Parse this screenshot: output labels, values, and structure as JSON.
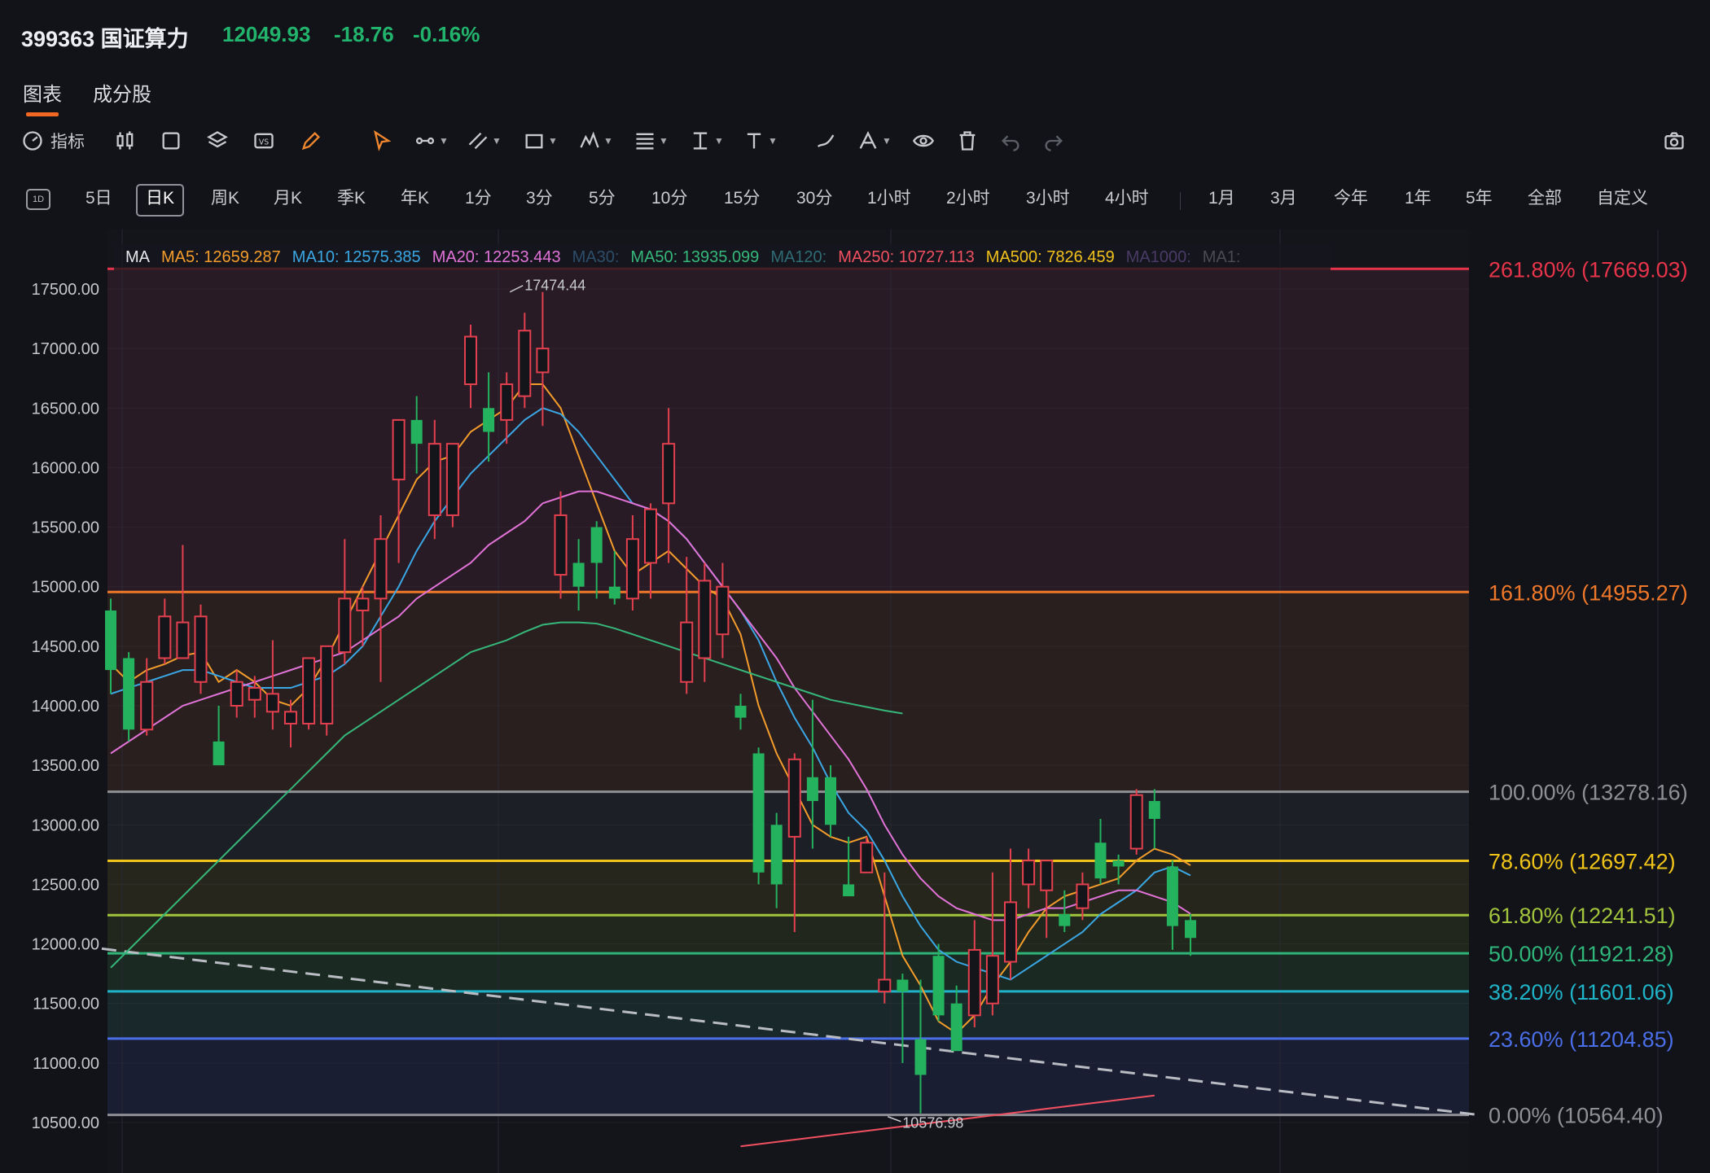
{
  "ticker": {
    "code_name": "399363 国证算力",
    "price": "12049.93",
    "change": "-18.76",
    "change_pct": "-0.16%"
  },
  "tabs": [
    {
      "label": "图表",
      "active": true
    },
    {
      "label": "成分股",
      "active": false
    }
  ],
  "toolbar": {
    "indicator_label": "指标",
    "icons": [
      "indicator-icon",
      "candle-type-icon",
      "square-icon",
      "layers-icon",
      "compare-icon",
      "pencil-icon",
      "cursor-icon",
      "line-tool-icon",
      "channel-icon",
      "shape-icon",
      "pattern-icon",
      "fib-icon",
      "measure-icon",
      "text-icon",
      "brush-icon",
      "annotation-icon",
      "eye-icon",
      "trash-icon",
      "undo-icon",
      "redo-icon",
      "camera-icon"
    ]
  },
  "periods": {
    "icon_label": "1D",
    "items": [
      "5日",
      "日K",
      "周K",
      "月K",
      "季K",
      "年K",
      "1分",
      "3分",
      "5分",
      "10分",
      "15分",
      "30分",
      "1小时",
      "2小时",
      "3小时",
      "4小时",
      "1月",
      "3月",
      "今年",
      "1年",
      "5年",
      "全部",
      "自定义"
    ],
    "active": "日K"
  },
  "ma_legend": [
    {
      "label": "MA",
      "color": "#e6e7ea"
    },
    {
      "label": "MA5: 12659.287",
      "color": "#f39c2b"
    },
    {
      "label": "MA10: 12575.385",
      "color": "#3aa6e3"
    },
    {
      "label": "MA20: 12253.443",
      "color": "#e173d8"
    },
    {
      "label": "MA30:",
      "color": "#2d4d6a"
    },
    {
      "label": "MA50: 13935.099",
      "color": "#36b77a"
    },
    {
      "label": "MA120:",
      "color": "#2f6b74"
    },
    {
      "label": "MA250: 10727.113",
      "color": "#f05060"
    },
    {
      "label": "MA500: 7826.459",
      "color": "#f2c11d"
    },
    {
      "label": "MA1000:",
      "color": "#4a3a66"
    },
    {
      "label": "MA1:",
      "color": "#4a4b52"
    }
  ],
  "chart_data": {
    "type": "candlestick",
    "y_axis": {
      "min": 10300,
      "max": 17800,
      "ticks": [
        17500,
        17000,
        16500,
        16000,
        15500,
        15000,
        14500,
        14000,
        13500,
        13000,
        12500,
        12000,
        11500,
        11000,
        10500
      ],
      "tick_labels": [
        "17500.00",
        "17000.00",
        "16500.00",
        "16000.00",
        "15500.00",
        "15000.00",
        "14500.00",
        "14000.00",
        "13500.00",
        "13000.00",
        "12500.00",
        "12000.00",
        "11500.00",
        "11000.00",
        "10500.00"
      ]
    },
    "annotations": [
      {
        "label": "17474.44",
        "value": 17474.44,
        "bar": 22
      },
      {
        "label": "10576.98",
        "value": 10576.98,
        "bar": 43
      }
    ],
    "fibonacci": [
      {
        "level": "261.80%",
        "value": 17669.03,
        "label": "261.80% (17669.03)",
        "color": "#e8344a"
      },
      {
        "level": "161.80%",
        "value": 14955.27,
        "label": "161.80% (14955.27)",
        "color": "#f0782a"
      },
      {
        "level": "100.00%",
        "value": 13278.16,
        "label": "100.00% (13278.16)",
        "color": "#8e9096"
      },
      {
        "level": "78.60%",
        "value": 12697.42,
        "label": "78.60% (12697.42)",
        "color": "#f0c419"
      },
      {
        "level": "61.80%",
        "value": 12241.51,
        "label": "61.80% (12241.51)",
        "color": "#a2c43c"
      },
      {
        "level": "50.00%",
        "value": 11921.28,
        "label": "50.00% (11921.28)",
        "color": "#2fb57a"
      },
      {
        "level": "38.20%",
        "value": 11601.06,
        "label": "38.20% (11601.06)",
        "color": "#1fb3c8"
      },
      {
        "level": "23.60%",
        "value": 11204.85,
        "label": "23.60% (11204.85)",
        "color": "#4a6ee8"
      },
      {
        "level": "0.00%",
        "value": 10564.4,
        "label": "0.00% (10564.40)",
        "color": "#8e9096"
      }
    ],
    "candles": [
      {
        "o": 14800,
        "h": 14900,
        "l": 14100,
        "c": 14300
      },
      {
        "o": 14400,
        "h": 14450,
        "l": 13700,
        "c": 13800
      },
      {
        "o": 13800,
        "h": 14400,
        "l": 13750,
        "c": 14200
      },
      {
        "o": 14400,
        "h": 14900,
        "l": 14350,
        "c": 14750
      },
      {
        "o": 14400,
        "h": 15350,
        "l": 14400,
        "c": 14700
      },
      {
        "o": 14200,
        "h": 14850,
        "l": 14100,
        "c": 14750
      },
      {
        "o": 13700,
        "h": 14000,
        "l": 13550,
        "c": 13500
      },
      {
        "o": 14000,
        "h": 14300,
        "l": 13900,
        "c": 14200
      },
      {
        "o": 14050,
        "h": 14250,
        "l": 13900,
        "c": 14150
      },
      {
        "o": 13950,
        "h": 14550,
        "l": 13800,
        "c": 14100
      },
      {
        "o": 13850,
        "h": 14050,
        "l": 13650,
        "c": 13950
      },
      {
        "o": 13850,
        "h": 14200,
        "l": 13800,
        "c": 14400
      },
      {
        "o": 13850,
        "h": 14500,
        "l": 13750,
        "c": 14500
      },
      {
        "o": 14450,
        "h": 15400,
        "l": 14350,
        "c": 14900
      },
      {
        "o": 14800,
        "h": 15000,
        "l": 14500,
        "c": 14900
      },
      {
        "o": 14900,
        "h": 15600,
        "l": 14200,
        "c": 15400
      },
      {
        "o": 15900,
        "h": 16300,
        "l": 15200,
        "c": 16400
      },
      {
        "o": 16400,
        "h": 16600,
        "l": 15950,
        "c": 16200
      },
      {
        "o": 15600,
        "h": 16400,
        "l": 15400,
        "c": 16200
      },
      {
        "o": 15600,
        "h": 16200,
        "l": 15500,
        "c": 16200
      },
      {
        "o": 16700,
        "h": 17200,
        "l": 16500,
        "c": 17100
      },
      {
        "o": 16500,
        "h": 16800,
        "l": 16050,
        "c": 16300
      },
      {
        "o": 16400,
        "h": 16800,
        "l": 16200,
        "c": 16700
      },
      {
        "o": 16600,
        "h": 17300,
        "l": 16500,
        "c": 17150
      },
      {
        "o": 16800,
        "h": 17474.44,
        "l": 16350,
        "c": 17000
      },
      {
        "o": 15100,
        "h": 15800,
        "l": 14900,
        "c": 15600
      },
      {
        "o": 15200,
        "h": 15400,
        "l": 14800,
        "c": 15000
      },
      {
        "o": 15500,
        "h": 15550,
        "l": 14900,
        "c": 15200
      },
      {
        "o": 15000,
        "h": 15300,
        "l": 14850,
        "c": 14900
      },
      {
        "o": 14900,
        "h": 15600,
        "l": 14800,
        "c": 15400
      },
      {
        "o": 15200,
        "h": 15700,
        "l": 14900,
        "c": 15650
      },
      {
        "o": 15700,
        "h": 16500,
        "l": 15200,
        "c": 16200
      },
      {
        "o": 14200,
        "h": 15250,
        "l": 14100,
        "c": 14700
      },
      {
        "o": 14400,
        "h": 15200,
        "l": 14200,
        "c": 15050
      },
      {
        "o": 14600,
        "h": 15200,
        "l": 14400,
        "c": 15000
      },
      {
        "o": 14000,
        "h": 14100,
        "l": 13800,
        "c": 13900
      },
      {
        "o": 13600,
        "h": 13650,
        "l": 12500,
        "c": 12600
      },
      {
        "o": 13000,
        "h": 13100,
        "l": 12300,
        "c": 12500
      },
      {
        "o": 12900,
        "h": 13600,
        "l": 12100,
        "c": 13550
      },
      {
        "o": 13400,
        "h": 14050,
        "l": 12800,
        "c": 13200
      },
      {
        "o": 13400,
        "h": 13500,
        "l": 12900,
        "c": 13000
      },
      {
        "o": 12500,
        "h": 12900,
        "l": 12400,
        "c": 12400
      },
      {
        "o": 12600,
        "h": 12900,
        "l": 12600,
        "c": 12850
      },
      {
        "o": 11600,
        "h": 12600,
        "l": 11500,
        "c": 11700
      },
      {
        "o": 11700,
        "h": 11750,
        "l": 11000,
        "c": 11600
      },
      {
        "o": 11200,
        "h": 11700,
        "l": 10576.98,
        "c": 10900
      },
      {
        "o": 11900,
        "h": 12000,
        "l": 11350,
        "c": 11400
      },
      {
        "o": 11500,
        "h": 11650,
        "l": 11400,
        "c": 11100
      },
      {
        "o": 11400,
        "h": 12200,
        "l": 11300,
        "c": 11950
      },
      {
        "o": 11500,
        "h": 12600,
        "l": 11400,
        "c": 11900
      },
      {
        "o": 11850,
        "h": 12800,
        "l": 11700,
        "c": 12350
      },
      {
        "o": 12500,
        "h": 12800,
        "l": 12300,
        "c": 12700
      },
      {
        "o": 12450,
        "h": 12700,
        "l": 12050,
        "c": 12700
      },
      {
        "o": 12250,
        "h": 12450,
        "l": 12100,
        "c": 12150
      },
      {
        "o": 12300,
        "h": 12600,
        "l": 12200,
        "c": 12500
      },
      {
        "o": 12850,
        "h": 13050,
        "l": 12500,
        "c": 12550
      },
      {
        "o": 12700,
        "h": 12750,
        "l": 12500,
        "c": 12650
      },
      {
        "o": 12800,
        "h": 13300,
        "l": 12750,
        "c": 13250
      },
      {
        "o": 13200,
        "h": 13300,
        "l": 12800,
        "c": 13050
      },
      {
        "o": 12650,
        "h": 12700,
        "l": 11950,
        "c": 12150
      },
      {
        "o": 12200,
        "h": 12250,
        "l": 11900,
        "c": 12050
      }
    ],
    "ma_lines": [
      {
        "name": "MA5",
        "color": "#f39c2b",
        "values": [
          14350,
          14200,
          14300,
          14350,
          14420,
          14450,
          14200,
          14300,
          14200,
          14050,
          14000,
          14150,
          14400,
          14700,
          15000,
          15300,
          15600,
          15900,
          16050,
          16100,
          16300,
          16400,
          16500,
          16700,
          16700,
          16500,
          16100,
          15700,
          15300,
          15100,
          15200,
          15300,
          15150,
          15000,
          14900,
          14600,
          14000,
          13600,
          13300,
          13000,
          12900,
          12850,
          12900,
          12400,
          11900,
          11650,
          11350,
          11250,
          11400,
          11650,
          11850,
          12100,
          12300,
          12400,
          12450,
          12500,
          12550,
          12700,
          12800,
          12750,
          12660
        ]
      },
      {
        "name": "MA10",
        "color": "#3aa6e3",
        "values": [
          14100,
          14150,
          14200,
          14250,
          14300,
          14300,
          14250,
          14200,
          14150,
          14150,
          14150,
          14200,
          14250,
          14350,
          14500,
          14750,
          15000,
          15300,
          15550,
          15750,
          15950,
          16100,
          16250,
          16400,
          16500,
          16450,
          16300,
          16100,
          15900,
          15700,
          15650,
          15550,
          15400,
          15200,
          15000,
          14800,
          14550,
          14200,
          13900,
          13650,
          13350,
          13100,
          12950,
          12700,
          12400,
          12150,
          11950,
          11850,
          11800,
          11750,
          11700,
          11800,
          11900,
          12000,
          12100,
          12250,
          12350,
          12450,
          12600,
          12650,
          12575
        ]
      },
      {
        "name": "MA20",
        "color": "#e173d8",
        "values": [
          13600,
          13700,
          13800,
          13900,
          14000,
          14050,
          14100,
          14150,
          14200,
          14250,
          14300,
          14350,
          14400,
          14450,
          14550,
          14650,
          14750,
          14900,
          15000,
          15100,
          15200,
          15350,
          15450,
          15550,
          15700,
          15750,
          15800,
          15800,
          15750,
          15700,
          15650,
          15550,
          15400,
          15200,
          15000,
          14800,
          14600,
          14400,
          14150,
          13950,
          13750,
          13550,
          13300,
          13000,
          12750,
          12550,
          12400,
          12300,
          12250,
          12200,
          12200,
          12250,
          12300,
          12300,
          12350,
          12400,
          12450,
          12450,
          12400,
          12350,
          12253
        ]
      },
      {
        "name": "MA50",
        "color": "#36b77a",
        "values": [
          11800,
          11950,
          12100,
          12250,
          12400,
          12550,
          12700,
          12850,
          13000,
          13150,
          13300,
          13450,
          13600,
          13750,
          13850,
          13950,
          14050,
          14150,
          14250,
          14350,
          14450,
          14500,
          14550,
          14620,
          14680,
          14700,
          14700,
          14690,
          14650,
          14600,
          14550,
          14500,
          14450,
          14400,
          14350,
          14300,
          14250,
          14200,
          14150,
          14100,
          14050,
          14020,
          13990,
          13960,
          13935
        ]
      }
    ],
    "trend_lines": [
      {
        "name": "dashed-trend",
        "color": "#b9bcc2",
        "from": {
          "bar": -0.5,
          "value": 11960
        },
        "to": {
          "bar": 76,
          "value": 10564.4
        }
      },
      {
        "name": "ma250-segment",
        "color": "#f05060",
        "from": {
          "bar": 35,
          "value": 10300
        },
        "to": {
          "bar": 58,
          "value": 10727.113
        }
      }
    ]
  }
}
